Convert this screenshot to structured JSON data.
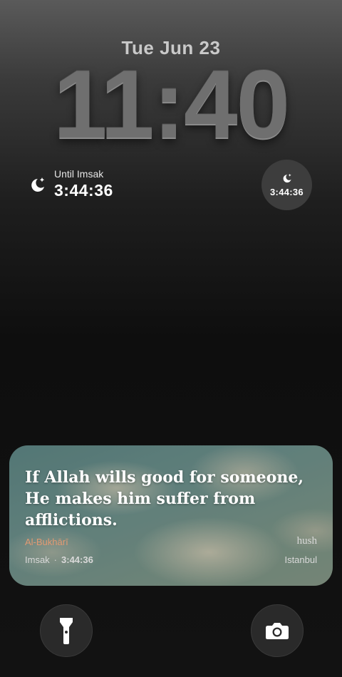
{
  "lockscreen": {
    "date": "Tue Jun 23",
    "time": "11:40"
  },
  "widgets": {
    "left": {
      "label": "Until Imsak",
      "value": "3:44:36",
      "icon": "moon-stars-icon"
    },
    "circle": {
      "value": "3:44:36",
      "icon": "moon-stars-icon"
    }
  },
  "card": {
    "quote": "If Allah wills good for someone, He makes him suffer from afflictions.",
    "source": "Al-Bukhārī",
    "brand": "hush",
    "prayer": "Imsak",
    "countdown": "3:44:36",
    "city": "Istanbul",
    "colors": {
      "source": "#e39a72",
      "sky": "#6f9590"
    }
  },
  "buttons": {
    "flashlight": {
      "icon": "flashlight-icon"
    },
    "camera": {
      "icon": "camera-icon"
    }
  }
}
